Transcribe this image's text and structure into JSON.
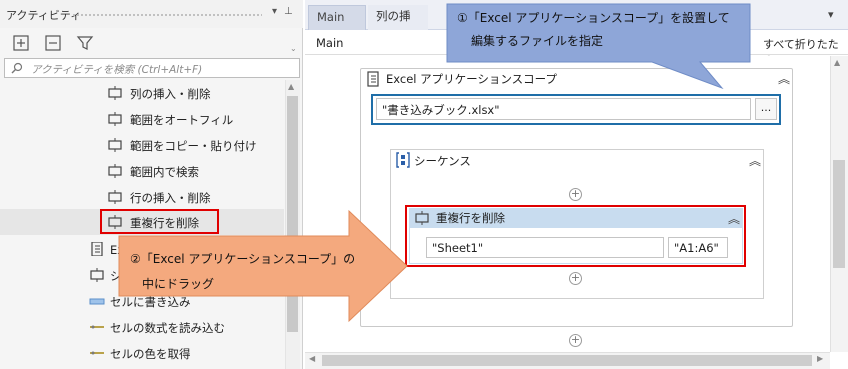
{
  "panel": {
    "title": "アクティビティ",
    "search_placeholder": "アクティビティを検索 (Ctrl+Alt+F)",
    "items": [
      {
        "label": "列の挿入・削除",
        "icon": "activity-icon"
      },
      {
        "label": "範囲をオートフィル",
        "icon": "activity-icon"
      },
      {
        "label": "範囲をコピー・貼り付け",
        "icon": "activity-icon"
      },
      {
        "label": "範囲内で検索",
        "icon": "activity-icon"
      },
      {
        "label": "行の挿入・削除",
        "icon": "activity-icon"
      },
      {
        "label": "重複行を削除",
        "icon": "activity-icon"
      },
      {
        "label": "Excel アプリケーションスコープ",
        "icon": "excel-scope-icon"
      },
      {
        "label": "シーケンス",
        "icon": "activity-icon"
      },
      {
        "label": "セルに書き込み",
        "icon": "write-cell-icon"
      },
      {
        "label": "セルの数式を読み込む",
        "icon": "formula-icon"
      },
      {
        "label": "セルの色を取得",
        "icon": "formula-icon"
      }
    ]
  },
  "designer": {
    "tabs": [
      {
        "label": "Main"
      },
      {
        "label": "列の挿入"
      }
    ],
    "breadcrumb": "Main",
    "collapse_all": "すべて折りたたみ",
    "scope": {
      "title": "Excel アプリケーションスコープ",
      "workbook_path": "\"書き込みブック.xlsx\"",
      "browse_label": "..."
    },
    "sequence": {
      "title": "シーケンス"
    },
    "remove_duplicates": {
      "title": "重複行を削除",
      "sheet": "\"Sheet1\"",
      "range": "\"A1:A6\""
    }
  },
  "callouts": {
    "blue_line1": "①「Excel アプリケーションスコープ」を設置して",
    "blue_line2": "編集するファイルを指定",
    "orange_line1": "②「Excel アプリケーションスコープ」の",
    "orange_line2": "中にドラッグ"
  },
  "colors": {
    "callout_blue": "#8ea6d8",
    "callout_orange": "#f4a97e",
    "highlight_red": "#e00000",
    "highlight_blue": "#1f6ea8",
    "activity_header": "#c8dcef"
  }
}
